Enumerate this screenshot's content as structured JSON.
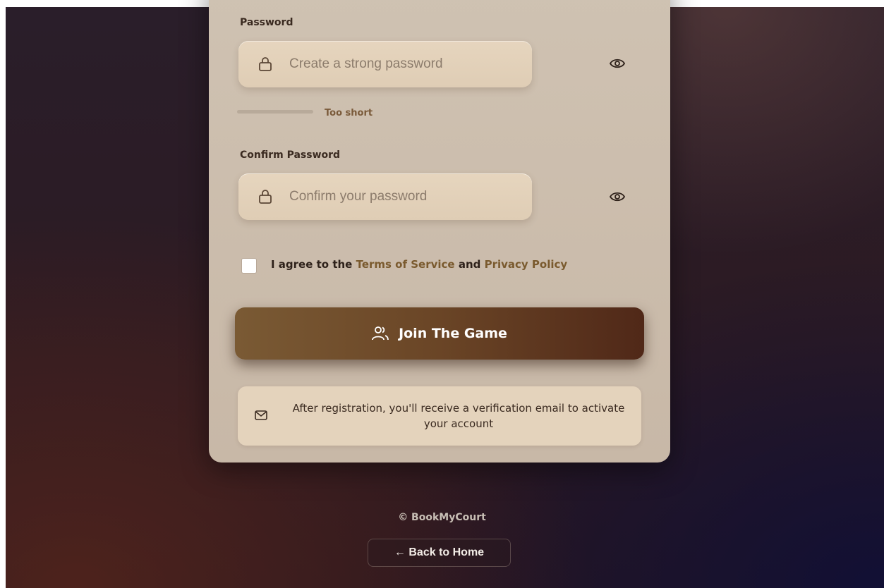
{
  "form": {
    "password_label": "Password",
    "password_placeholder": "Create a strong password",
    "strength_text": "Too short",
    "confirm_label": "Confirm Password",
    "confirm_placeholder": "Confirm your password",
    "agree_prefix": "I agree to the ",
    "terms_link": "Terms of Service",
    "agree_and": " and ",
    "privacy_link": "Privacy Policy",
    "submit_label": "Join The Game",
    "info_text": "After registration, you'll receive a verification email to activate your account"
  },
  "footer": {
    "copyright": "© BookMyCourt",
    "back_label": "← Back to Home"
  },
  "icons": {
    "password_lock": "lock-icon",
    "password_eye": "eye-icon",
    "confirm_lock": "lock-icon",
    "confirm_eye": "eye-icon",
    "join": "users-icon",
    "info": "mail-icon"
  },
  "colors": {
    "accent_brown": "#7a5a34",
    "accent_dark": "#502818",
    "link": "#7a5a2e",
    "card": "#cfc2b2",
    "input": "#e6d5be"
  }
}
